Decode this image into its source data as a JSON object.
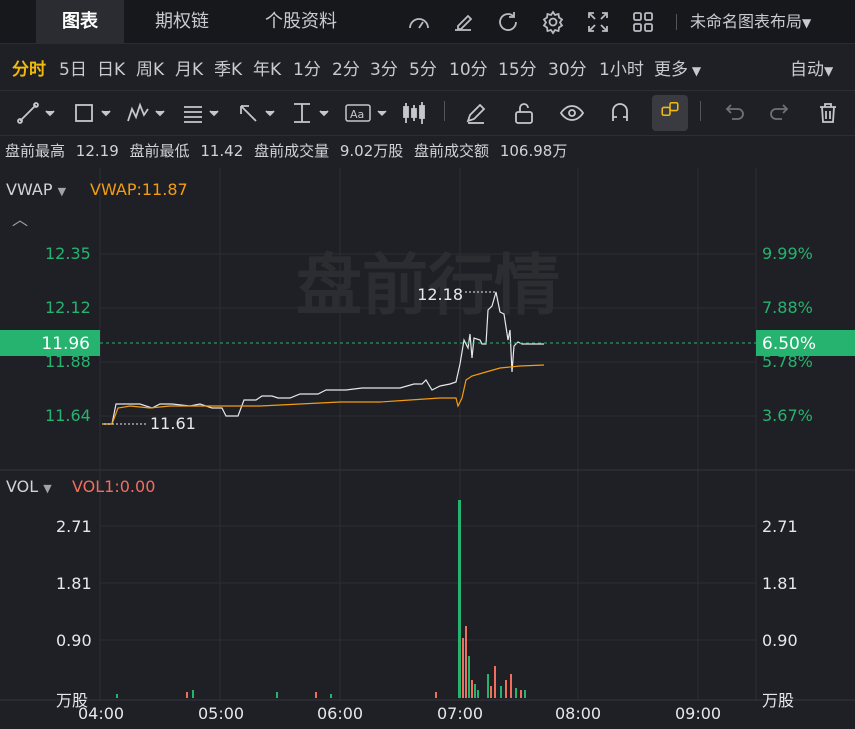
{
  "tabs": [
    "图表",
    "期权链",
    "个股资料"
  ],
  "layout_name": "未命名图表布局",
  "periods": [
    "分时",
    "5日",
    "日K",
    "周K",
    "月K",
    "季K",
    "年K",
    "1分",
    "2分",
    "3分",
    "5分",
    "10分",
    "15分",
    "30分",
    "1小时",
    "更多"
  ],
  "auto_label": "自动",
  "info": {
    "high_label": "盘前最高",
    "high": "12.19",
    "low_label": "盘前最低",
    "low": "11.42",
    "vol_label": "盘前成交量",
    "vol": "9.02万股",
    "amt_label": "盘前成交额",
    "amt": "106.98万"
  },
  "watermark": "盘前行情",
  "vwap": {
    "name": "VWAP",
    "value": "VWAP:11.87"
  },
  "price_axis_left": [
    "12.35",
    "12.12",
    "11.88",
    "11.64"
  ],
  "price_axis_right": [
    "9.99%",
    "7.88%",
    "5.78%",
    "3.67%"
  ],
  "current_price": "11.96",
  "current_pct": "6.50%",
  "peak_label": "12.18",
  "trough_label": "11.61",
  "vol_panel": {
    "name": "VOL",
    "value": "VOL1:0.00"
  },
  "vol_axis": [
    "2.71",
    "1.81",
    "0.90",
    "万股"
  ],
  "time_axis": [
    "04:00",
    "05:00",
    "06:00",
    "07:00",
    "08:00",
    "09:00"
  ],
  "colors": {
    "up": "#25b36f",
    "down": "#f06e5e",
    "vwap": "#f39c12",
    "accent": "#f0b90b"
  },
  "chart_data": {
    "type": "line",
    "series": [
      {
        "name": "VWAP",
        "x": [
          "04:00",
          "04:10",
          "04:30",
          "05:00",
          "05:20",
          "06:00",
          "06:30",
          "06:50",
          "07:00",
          "07:05",
          "07:10",
          "07:20",
          "07:30",
          "07:40"
        ],
        "values": [
          11.61,
          11.66,
          11.66,
          11.66,
          11.67,
          11.68,
          11.68,
          11.7,
          11.71,
          11.82,
          11.85,
          11.86,
          11.87,
          11.87
        ]
      }
    ]
  }
}
